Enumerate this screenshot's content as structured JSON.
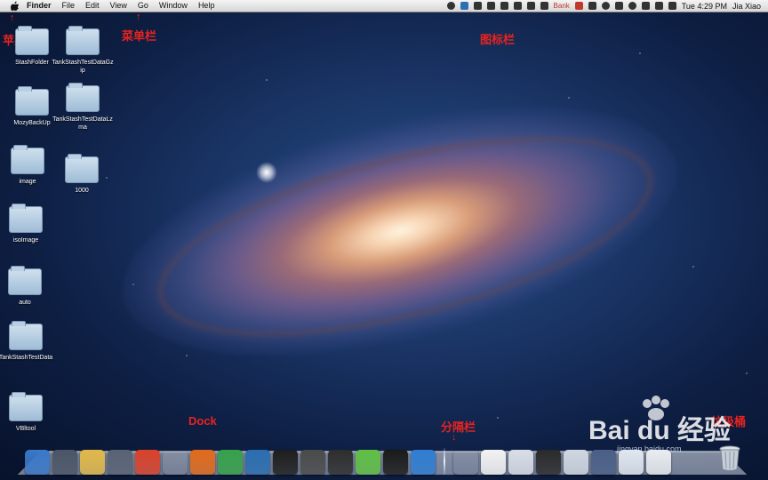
{
  "menubar": {
    "app_name": "Finder",
    "items": [
      "File",
      "Edit",
      "View",
      "Go",
      "Window",
      "Help"
    ],
    "status": {
      "bank_label": "Bank",
      "datetime": "Tue 4:29 PM",
      "user": "Jia Xiao"
    }
  },
  "annotations": {
    "apple_menu": "苹果菜单",
    "menu_bar": "菜单栏",
    "icon_bar": "图标栏",
    "dock": "Dock",
    "separator": "分隔栏",
    "trash": "垃圾桶",
    "arrow": "↑",
    "arrow_down": "↓"
  },
  "desktop_icons": [
    {
      "label": "StashFolder"
    },
    {
      "label": "TankStashTestDataGzip"
    },
    {
      "label": "MozyBackUp"
    },
    {
      "label": "TankStashTestDataLzma"
    },
    {
      "label": "image"
    },
    {
      "label": "1000"
    },
    {
      "label": "isoImage"
    },
    {
      "label": "auto"
    },
    {
      "label": "TankStashTestData"
    },
    {
      "label": "VBltool"
    }
  ],
  "dock": {
    "apps": [
      {
        "name": "finder",
        "color": "#3a78c9"
      },
      {
        "name": "app-2",
        "color": "#4a5566"
      },
      {
        "name": "app-3-lock",
        "color": "#e0b84a"
      },
      {
        "name": "launchpad",
        "color": "#596273"
      },
      {
        "name": "chrome",
        "color": "#d9412b"
      },
      {
        "name": "app-6",
        "color": "#777"
      },
      {
        "name": "firefox",
        "color": "#e06a1b"
      },
      {
        "name": "app-8-green",
        "color": "#35a14a"
      },
      {
        "name": "app-9-blue",
        "color": "#2a6db0"
      },
      {
        "name": "terminal-1",
        "color": "#1d1d1d"
      },
      {
        "name": "app-11",
        "color": "#4a4a4a"
      },
      {
        "name": "console",
        "color": "#2d2d2d"
      },
      {
        "name": "evernote",
        "color": "#5fbf45"
      },
      {
        "name": "terminal-2",
        "color": "#1a1a1a"
      },
      {
        "name": "safari",
        "color": "#2f7dd1"
      }
    ],
    "docs": [
      {
        "name": "doc-1",
        "color": "#888"
      },
      {
        "name": "doc-2",
        "color": "#f2f2f2"
      },
      {
        "name": "doc-3",
        "color": "#d8dde6"
      },
      {
        "name": "doc-4",
        "color": "#2a2a2a"
      },
      {
        "name": "doc-5",
        "color": "#cfd6e0"
      },
      {
        "name": "doc-6",
        "color": "#4a5f86"
      },
      {
        "name": "doc-7",
        "color": "#dfe6ef"
      },
      {
        "name": "doc-8",
        "color": "#e9ecf0"
      }
    ]
  },
  "watermark": {
    "brand": "Bai du 经验",
    "url": "jingyan.baidu.com"
  }
}
